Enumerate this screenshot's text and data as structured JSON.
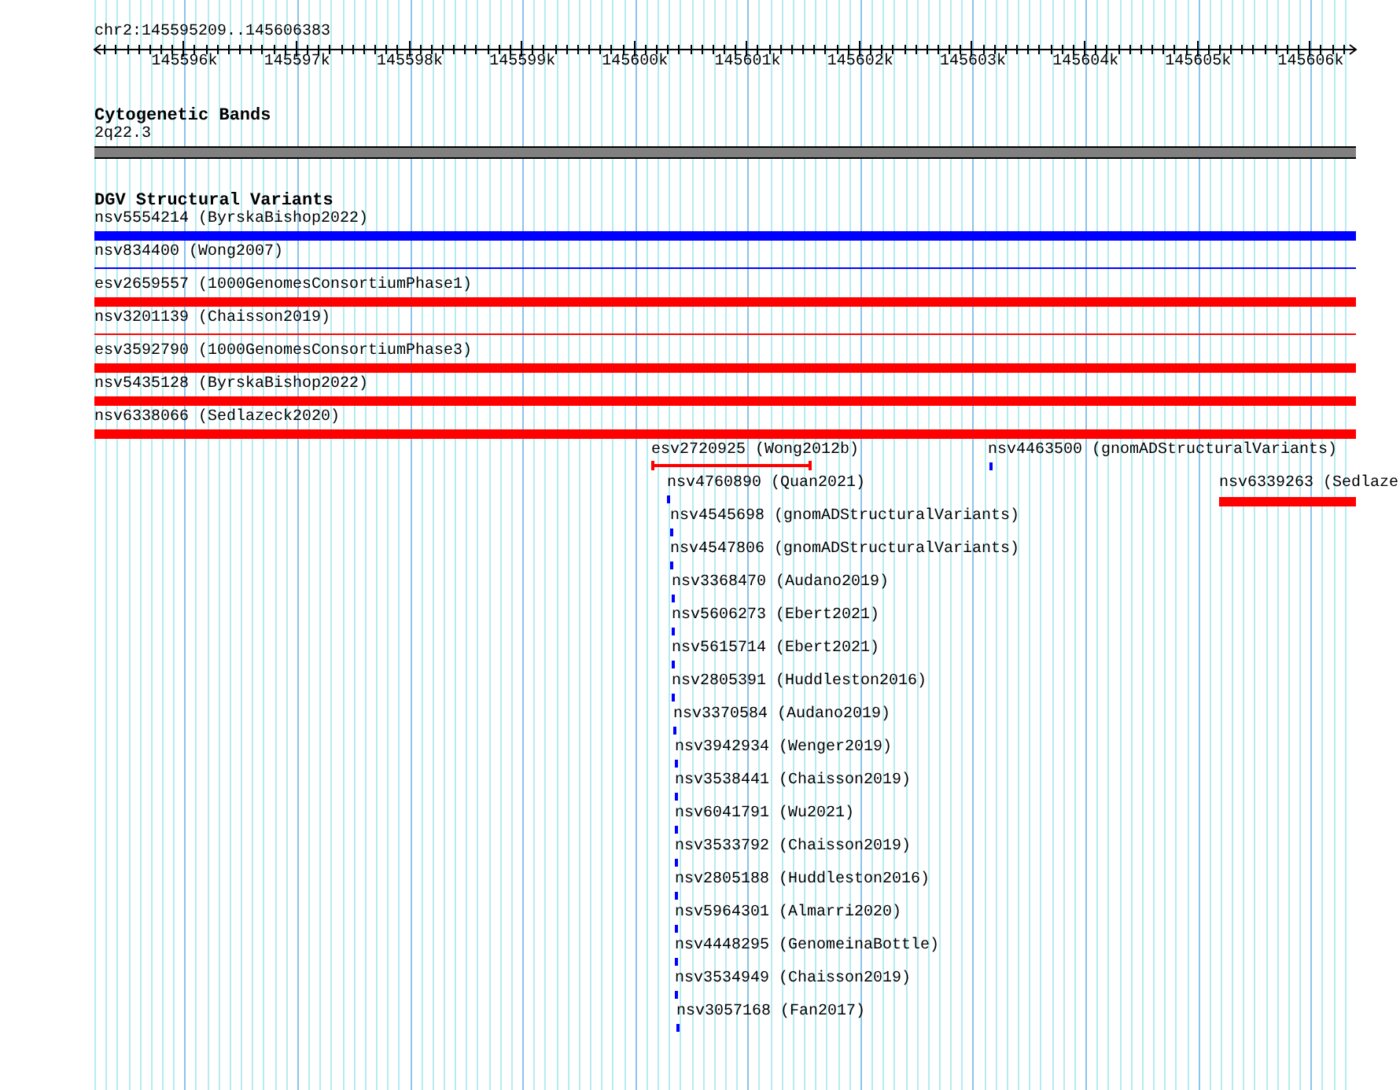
{
  "ruler": {
    "location": "chr2:145595209..145606383",
    "ticks": [
      "145596k",
      "145597k",
      "145598k",
      "145599k",
      "145600k",
      "145601k",
      "145602k",
      "145603k",
      "145604k",
      "145605k",
      "145606k"
    ]
  },
  "tracks": [
    {
      "title": "Cytogenetic Bands",
      "features": [
        {
          "label": "2q22.3",
          "kind": "band"
        }
      ]
    },
    {
      "title": "DGV Structural Variants",
      "features": [
        {
          "label": "nsv5554214 (ByrskaBishop2022)",
          "kind": "bar",
          "color": "#0000ff"
        },
        {
          "label": "nsv834400 (Wong2007)",
          "kind": "line",
          "color": "#0000ff"
        },
        {
          "label": "esv2659557 (1000GenomesConsortiumPhase1)",
          "kind": "bar",
          "color": "#ff0000"
        },
        {
          "label": "nsv3201139 (Chaisson2019)",
          "kind": "line",
          "color": "#ff0000"
        },
        {
          "label": "esv3592790 (1000GenomesConsortiumPhase3)",
          "kind": "bar",
          "color": "#ff0000"
        },
        {
          "label": "nsv5435128 (ByrskaBishop2022)",
          "kind": "bar",
          "color": "#ff0000"
        },
        {
          "label": "nsv6338066 (Sedlazeck2020)",
          "kind": "bar",
          "color": "#ff0000"
        },
        {
          "label": "esv2720925 (Wong2012b)",
          "kind": "bracket",
          "color": "#ff0000"
        },
        {
          "label": "nsv4463500 (gnomADStructuralVariants)",
          "kind": "bar",
          "color": "#0000ff"
        },
        {
          "label": "nsv4760890 (Quan2021)",
          "kind": "bar",
          "color": "#0000ff"
        },
        {
          "label": "nsv6339263 (Sedlaze",
          "kind": "bar",
          "color": "#ff0000"
        },
        {
          "label": "nsv4545698 (gnomADStructuralVariants)",
          "kind": "bar",
          "color": "#0000ff"
        },
        {
          "label": "nsv4547806 (gnomADStructuralVariants)",
          "kind": "bar",
          "color": "#0000ff"
        },
        {
          "label": "nsv3368470 (Audano2019)",
          "kind": "bar",
          "color": "#0000ff"
        },
        {
          "label": "nsv5606273 (Ebert2021)",
          "kind": "bar",
          "color": "#0000ff"
        },
        {
          "label": "nsv5615714 (Ebert2021)",
          "kind": "bar",
          "color": "#0000ff"
        },
        {
          "label": "nsv2805391 (Huddleston2016)",
          "kind": "bar",
          "color": "#0000ff"
        },
        {
          "label": "nsv3370584 (Audano2019)",
          "kind": "bar",
          "color": "#0000ff"
        },
        {
          "label": "nsv3942934 (Wenger2019)",
          "kind": "bar",
          "color": "#0000ff"
        },
        {
          "label": "nsv3538441 (Chaisson2019)",
          "kind": "bar",
          "color": "#0000ff"
        },
        {
          "label": "nsv6041791 (Wu2021)",
          "kind": "bar",
          "color": "#0000ff"
        },
        {
          "label": "nsv3533792 (Chaisson2019)",
          "kind": "bar",
          "color": "#0000ff"
        },
        {
          "label": "nsv2805188 (Huddleston2016)",
          "kind": "bar",
          "color": "#0000ff"
        },
        {
          "label": "nsv5964301 (Almarri2020)",
          "kind": "bar",
          "color": "#0000ff"
        },
        {
          "label": "nsv4448295 (GenomeinaBottle)",
          "kind": "bar",
          "color": "#0000ff"
        },
        {
          "label": "nsv3534949 (Chaisson2019)",
          "kind": "bar",
          "color": "#0000ff"
        },
        {
          "label": "nsv3057168 (Fan2017)",
          "kind": "bar",
          "color": "#0000ff"
        }
      ]
    }
  ]
}
